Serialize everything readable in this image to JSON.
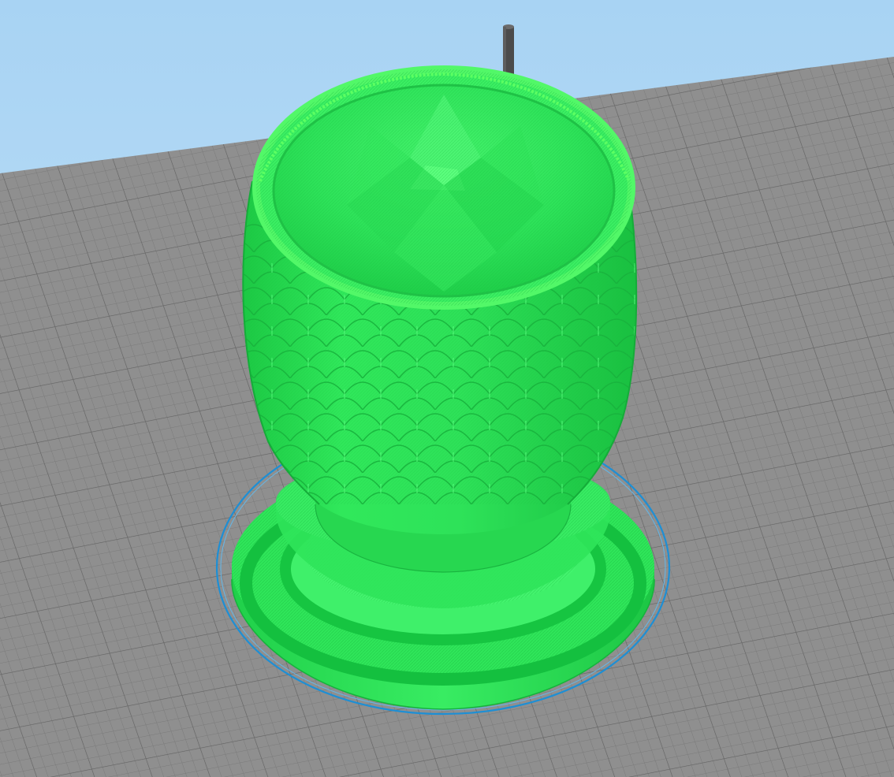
{
  "scene": {
    "type": "3d-print-layer-preview",
    "object": "vase-with-scale-pattern",
    "colors": {
      "sky_top": "#a9d4f4",
      "sky_bottom": "#c6e4f8",
      "bed": "#8e8e8e",
      "grid_minor": "#7b7b7b",
      "grid_major": "#6a6a6a",
      "model_light": "#3df56a",
      "model_mid": "#22e04c",
      "model_dark": "#14b83a",
      "model_bright": "#63ff73",
      "skirt": "#1e90d6",
      "nozzle": "#4a4a4a"
    },
    "icons": {
      "nozzle": "extruder-nozzle-icon"
    }
  }
}
